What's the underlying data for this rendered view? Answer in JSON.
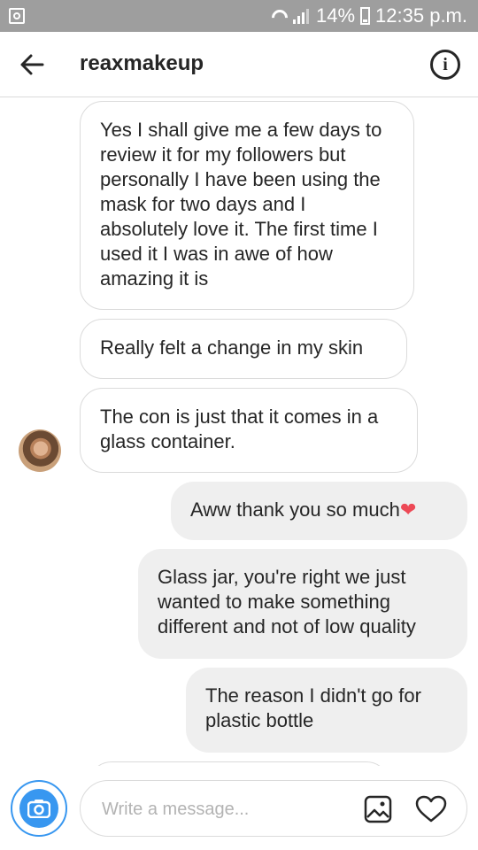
{
  "status_bar": {
    "battery": "14%",
    "time": "12:35 p.m."
  },
  "header": {
    "username": "reaxmakeup"
  },
  "messages": [
    {
      "from": "them",
      "text": "Yes I shall give me a few days to review it for my followers but personally I have been using the mask for two days and I absolutely love it. The first time I used it I was in awe of how amazing it is"
    },
    {
      "from": "them",
      "text": "Really felt a change in my skin"
    },
    {
      "from": "them",
      "text": "The con is just that it comes in a glass container."
    },
    {
      "from": "me",
      "text": "Aww thank you so much",
      "emoji": "❤"
    },
    {
      "from": "me",
      "text": "Glass jar, you're right we just wanted to make something different and not of low quality"
    },
    {
      "from": "me",
      "text": "The reason I didn't go for plastic bottle"
    }
  ],
  "composer": {
    "placeholder": "Write a message..."
  },
  "colors": {
    "status_bar": "#9e9e9e",
    "accent": "#3897f0",
    "heart": "#ed4956",
    "bubble_out": "#efefef"
  },
  "icons": {
    "back": "arrow-left-icon",
    "info": "info-icon",
    "camera": "camera-icon",
    "gallery": "image-icon",
    "like": "heart-icon"
  }
}
